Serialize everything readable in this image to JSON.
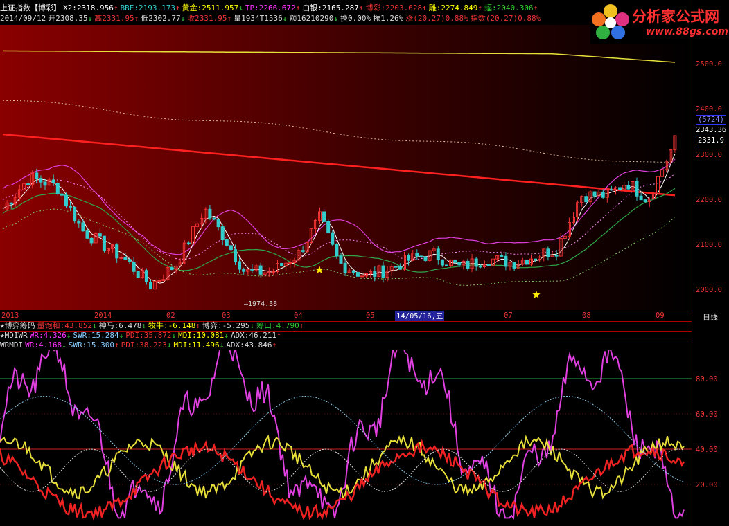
{
  "header": {
    "line1": [
      {
        "text": "上证指数【博彩】",
        "c": "#ffffff"
      },
      {
        "text": "X2:2318.956",
        "c": "#ffffff"
      },
      {
        "text": "↑",
        "c": "#e33"
      },
      {
        "text": "BBE:2193.173",
        "c": "#3cc"
      },
      {
        "text": "↑",
        "c": "#e33"
      },
      {
        "text": "黄金:2511.957",
        "c": "#ff0"
      },
      {
        "text": "↓",
        "c": "#3c3"
      },
      {
        "text": "TP:2266.672",
        "c": "#f3f"
      },
      {
        "text": "↑",
        "c": "#e33"
      },
      {
        "text": "白银:2165.287",
        "c": "#fff"
      },
      {
        "text": "↑",
        "c": "#e33"
      },
      {
        "text": "博彩:2203.628",
        "c": "#e33"
      },
      {
        "text": "↑",
        "c": "#e33"
      },
      {
        "text": "雕:2274.849",
        "c": "#ff0"
      },
      {
        "text": "↑",
        "c": "#e33"
      },
      {
        "text": "蝠:2040.306",
        "c": "#3c3"
      },
      {
        "text": "↑",
        "c": "#e33"
      }
    ],
    "line2": [
      {
        "text": "2014/09/12",
        "c": "#ddd"
      },
      {
        "text": "开2308.35",
        "c": "#ddd"
      },
      {
        "text": "↓",
        "c": "#3c3"
      },
      {
        "text": "高2331.95",
        "c": "#e33"
      },
      {
        "text": "↑",
        "c": "#e33"
      },
      {
        "text": "低2302.77",
        "c": "#ddd"
      },
      {
        "text": "↓",
        "c": "#3c3"
      },
      {
        "text": "收2331.95",
        "c": "#e33"
      },
      {
        "text": "↑",
        "c": "#e33"
      },
      {
        "text": "量1934T1536",
        "c": "#ddd"
      },
      {
        "text": "↓",
        "c": "#3c3"
      },
      {
        "text": "额16210290",
        "c": "#ddd"
      },
      {
        "text": "↓",
        "c": "#3c3"
      },
      {
        "text": "换0.00%",
        "c": "#ddd"
      },
      {
        "text": "振1.26%",
        "c": "#ddd"
      },
      {
        "text": "涨(20.27)0.88%",
        "c": "#e33"
      },
      {
        "text": "指数(20.27)0.88%",
        "c": "#e33"
      }
    ]
  },
  "logo": {
    "title": "分析家公式网",
    "url": "www.88gs.com"
  },
  "price_axis": {
    "ticks": [
      "2500.0",
      "2400.0",
      "2300.0",
      "2200.0",
      "2100.0",
      "2000.0"
    ],
    "marker_top": "(5724)",
    "marker_hi": "2343.36",
    "marker_cur": "2331.9"
  },
  "low_label": "1974.38",
  "date_axis": {
    "labels": [
      "2013",
      "2014",
      "02",
      "03",
      "04",
      "05",
      "07",
      "08",
      "09"
    ],
    "highlight": "14/05/16,五",
    "period": "日线"
  },
  "ind1": [
    {
      "text": "★博弈筹码",
      "c": "#ddd"
    },
    {
      "text": "量饱和:43.852",
      "c": "#e33"
    },
    {
      "text": "↓",
      "c": "#3c3"
    },
    {
      "text": "神马:6.478",
      "c": "#ddd"
    },
    {
      "text": "↓",
      "c": "#3c3"
    },
    {
      "text": "牧牛:-6.148",
      "c": "#ff0"
    },
    {
      "text": "↑",
      "c": "#e33"
    },
    {
      "text": "博弈:-5.295",
      "c": "#ddd"
    },
    {
      "text": "↓",
      "c": "#3c3"
    },
    {
      "text": "筹口:4.790",
      "c": "#3c3"
    },
    {
      "text": "↑",
      "c": "#e33"
    }
  ],
  "ind2": [
    {
      "text": "★MDIWR",
      "c": "#ddd"
    },
    {
      "text": "WR:4.326",
      "c": "#f3f"
    },
    {
      "text": "↓",
      "c": "#3c3"
    },
    {
      "text": "SWR:15.284",
      "c": "#8cf"
    },
    {
      "text": "↓",
      "c": "#3c3"
    },
    {
      "text": "PDI:35.872",
      "c": "#e33"
    },
    {
      "text": "↓",
      "c": "#3c3"
    },
    {
      "text": "MDI:10.081",
      "c": "#ff0"
    },
    {
      "text": "↓",
      "c": "#3c3"
    },
    {
      "text": "ADX:46.211",
      "c": "#ddd"
    },
    {
      "text": "↑",
      "c": "#e33"
    }
  ],
  "ind3": [
    {
      "text": "WRMDI",
      "c": "#ddd"
    },
    {
      "text": "WR:4.168",
      "c": "#f3f"
    },
    {
      "text": "↓",
      "c": "#3c3"
    },
    {
      "text": "SWR:15.300",
      "c": "#8cf"
    },
    {
      "text": "↑",
      "c": "#e33"
    },
    {
      "text": "PDI:38.223",
      "c": "#e33"
    },
    {
      "text": "↓",
      "c": "#3c3"
    },
    {
      "text": "MDI:11.496",
      "c": "#ff0"
    },
    {
      "text": "↓",
      "c": "#3c3"
    },
    {
      "text": "ADX:43.846",
      "c": "#ddd"
    },
    {
      "text": "↑",
      "c": "#e33"
    }
  ],
  "osc_axis": {
    "ticks": [
      "80.00",
      "60.00",
      "40.00",
      "20.00"
    ]
  },
  "colors": {
    "up": "#ee3333",
    "down": "#33cccc",
    "grid": "#aa0000",
    "yellow": "#e8e03a",
    "magenta": "#e040e0",
    "green": "#2ea84a"
  }
}
